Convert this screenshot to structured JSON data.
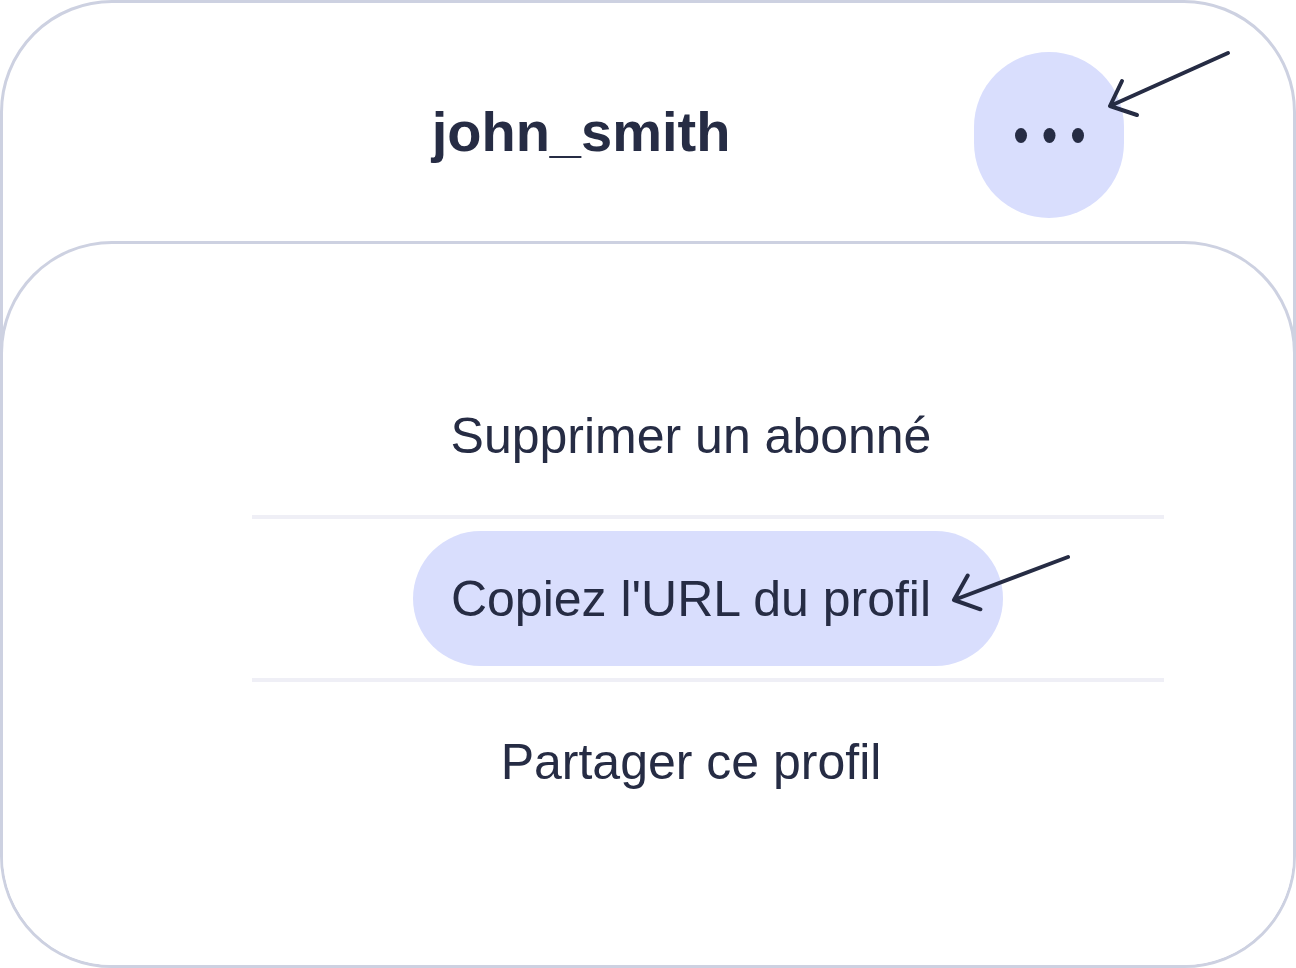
{
  "header": {
    "title": "john_smith",
    "more_button": {
      "highlighted": true,
      "annotated": true
    }
  },
  "menu": {
    "items": [
      {
        "label": "Supprimer un abonné",
        "selected": false,
        "annotated": false
      },
      {
        "label": "Copiez l'URL du profil",
        "selected": true,
        "annotated": true
      },
      {
        "label": "Partager ce profil",
        "selected": false,
        "annotated": false
      }
    ]
  }
}
